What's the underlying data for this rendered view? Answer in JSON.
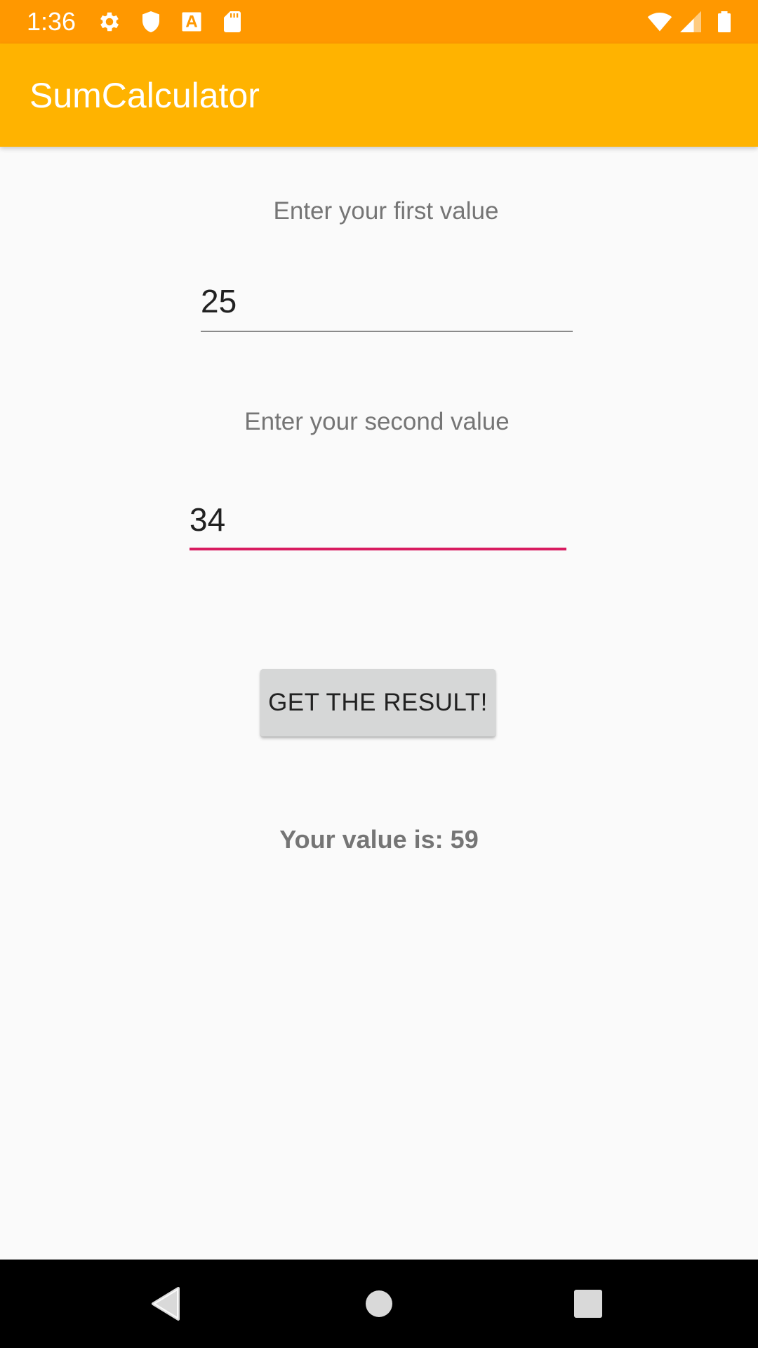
{
  "status_bar": {
    "time": "1:36",
    "icons": [
      "settings-icon",
      "shield-icon",
      "font-a-icon",
      "sd-card-icon",
      "wifi-icon",
      "cell-signal-icon",
      "battery-icon"
    ],
    "background_color": "#ff9800"
  },
  "app_bar": {
    "title": "SumCalculator",
    "background_color": "#ffb300"
  },
  "form": {
    "first_label": "Enter your first value",
    "first_value": "25",
    "second_label": "Enter your second value",
    "second_value": "34",
    "focused_underline_color": "#d81b60",
    "button_label": "GET THE RESULT!",
    "result_text": "Your value is: 59"
  },
  "nav_bar": {
    "icons": [
      "back-icon",
      "home-icon",
      "recents-icon"
    ]
  }
}
